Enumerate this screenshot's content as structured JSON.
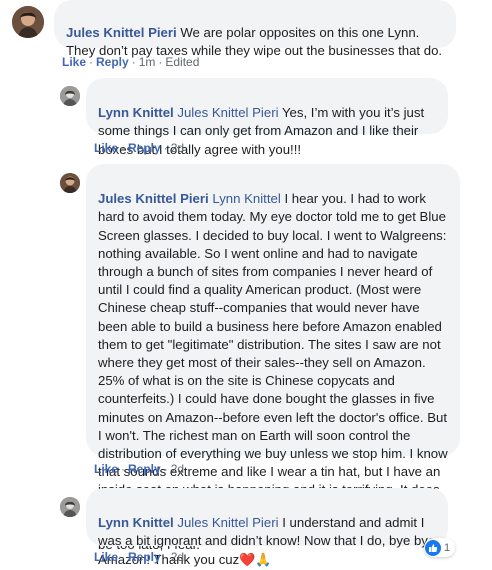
{
  "comments": [
    {
      "author": "Jules Knittel Pieri",
      "mention": "",
      "text": " We are polar opposites on this one Lynn. They don’t pay taxes while they wipe out the businesses that do.",
      "actions": {
        "like": "Like",
        "reply": "Reply",
        "time": "1m",
        "edited": "Edited"
      }
    },
    {
      "author": "Lynn Knittel",
      "mention": "Jules Knittel Pieri",
      "text": " Yes, I’m with you it’s just some things I can only get from Amazon and I like their boxes but I totally agree with you!!!",
      "actions": {
        "like": "Like",
        "reply": "Reply",
        "time": "2d"
      }
    },
    {
      "author": "Jules Knittel Pieri",
      "mention": "Lynn Knittel",
      "text": " I hear you. I had to work hard to avoid them today. My eye doctor told me to get Blue Screen glasses. I decided to buy local. I went to Walgreens: nothing available. So I went online and had to navigate through a bunch of sites from companies I never heard of until I could find a quality American product. (Most were Chinese cheap stuff--companies that would never have been able to build a business here before Amazon enabled them to get \"legitimate\" distribution. The sites I saw are not where they get most of their sales--they sell on Amazon. 25% of what is on the site is Chinese copycats and counterfeits.) I could have done bought the glasses in five minutes on Amazon--before even left the doctor's office. But I won't. The richest man on Earth will soon control the distribution of everything we buy unless we stop him. I know that sounds extreme and like I wear a tin hat, but I have an inside seat on what is happening and it is terrifying. It does take effort from each of us. Alas, people don't know why they should avoid Amazon--and what it is at stake. It may be too late, I fear.",
      "actions": {
        "like": "Like",
        "reply": "Reply",
        "time": "2d"
      }
    },
    {
      "author": "Lynn Knittel",
      "mention": "Jules Knittel Pieri",
      "text": " I understand and admit I was a bit ignorant and didn’t know! Now that I do, bye bye Amazon! Thank you cuz",
      "emojis": "❤️🙏",
      "actions": {
        "like": "Like",
        "reply": "Reply",
        "time": "2d"
      },
      "reaction_count": "1"
    }
  ],
  "colors": {
    "link": "#385898",
    "action": "#4267b2",
    "bubble": "#f2f3f5",
    "like_badge": "#1877f2"
  }
}
